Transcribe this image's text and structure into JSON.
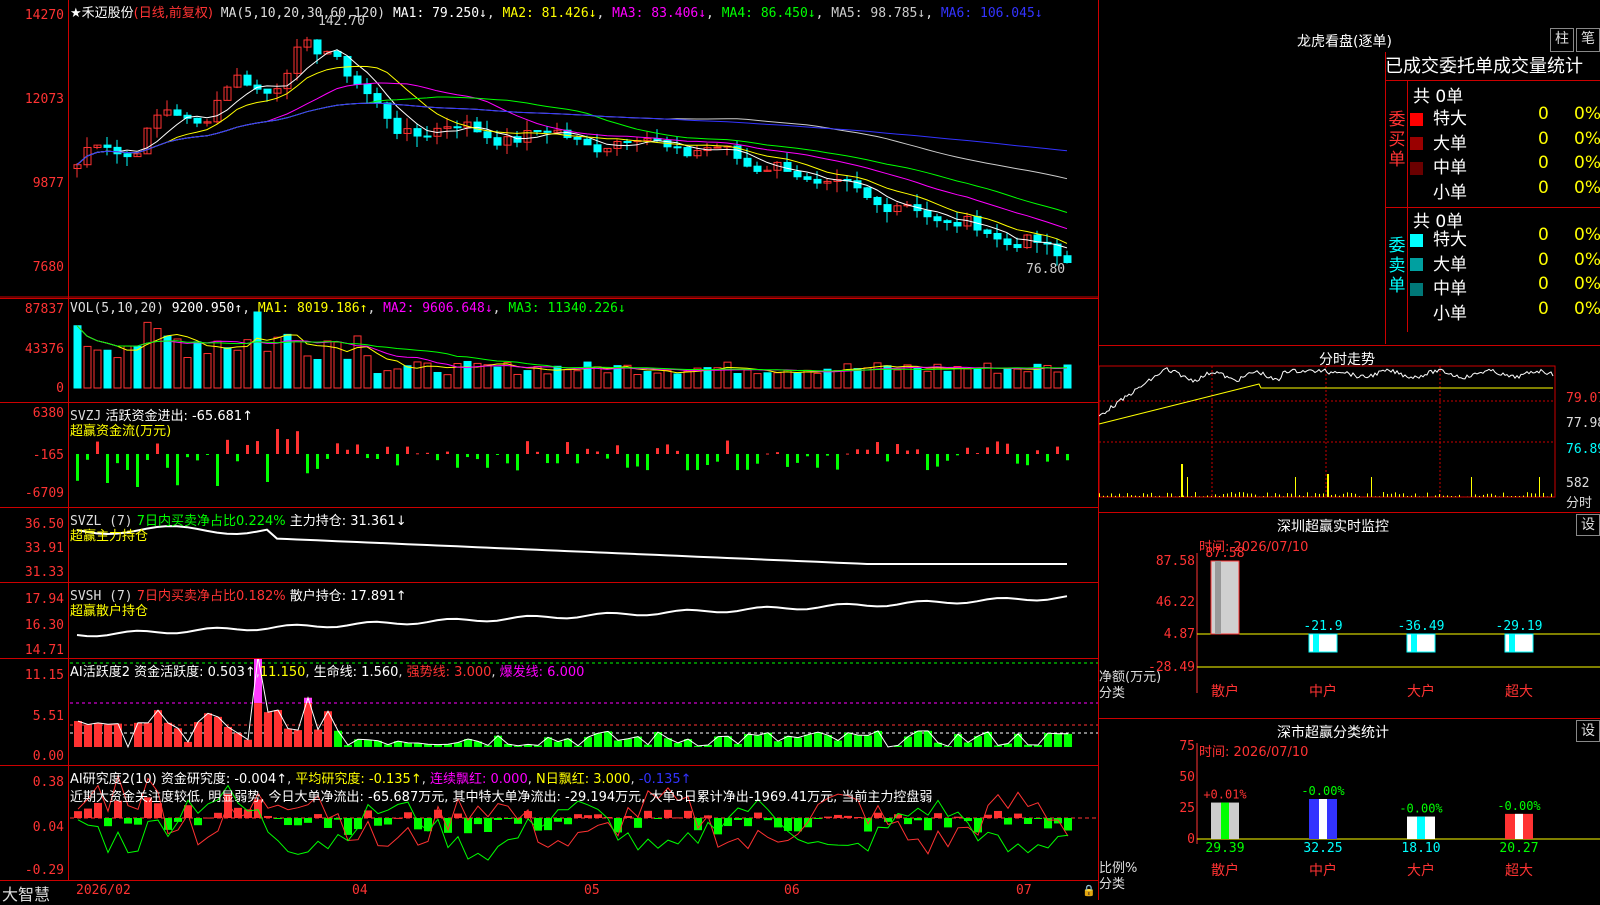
{
  "stock": {
    "name": "★禾迈股份",
    "mode": "(日线,前复权)"
  },
  "price_panel": {
    "ma_label": "MA(5,10,20,30,60,120)",
    "ma1": "MA1: 79.250↓",
    "ma2": "MA2: 81.426↓",
    "ma3": "MA3: 83.406↓",
    "ma4": "MA4: 86.450↓",
    "ma5": "MA5: 98.785↓",
    "ma6": "MA6: 106.045↓",
    "yticks": [
      "14270",
      "12073",
      "9877",
      "7680"
    ],
    "high_label": "142.70",
    "low_label": "76.80"
  },
  "vol_panel": {
    "label": "VOL(5,10,20)",
    "val": "9200.950↑",
    "ma1": "MA1: 8019.186↑",
    "ma2": "MA2: 9606.648↓",
    "ma3": "MA3: 11340.226↓",
    "yticks": [
      "87837",
      "43376",
      "0"
    ]
  },
  "svzj_panel": {
    "label": "SVZJ",
    "title": "活跃资金进出: -65.681↑",
    "sub": "超赢资金流(万元)",
    "yticks": [
      "6380",
      "-165",
      "-6709"
    ]
  },
  "svzl_panel": {
    "label": "SVZL (7)",
    "t1": "7日内买卖净占比0.224%",
    "t2": "主力持仓: 31.361↓",
    "sub": "超赢主力持仓",
    "yticks": [
      "36.50",
      "33.91",
      "31.33"
    ]
  },
  "svsh_panel": {
    "label": "SVSH (7)",
    "t1": "7日内买卖净占比0.182%",
    "t2": "散户持仓: 17.891↑",
    "sub": "超赢散户持仓",
    "yticks": [
      "17.94",
      "16.30",
      "14.71"
    ]
  },
  "ai_panel": {
    "label": "AI活跃度2",
    "t1": "资金活跃度: 0.503↑",
    "t2": "11.150",
    "t3": "生命线: 1.560",
    "t4": "强势线: 3.000",
    "t5": "爆发线: 6.000",
    "yticks": [
      "11.15",
      "5.51",
      "0.00"
    ]
  },
  "res_panel": {
    "label": "AI研究度2(10)",
    "t1": "资金研究度: -0.004↑",
    "t2": "平均研究度: -0.135↑",
    "t3": "连续飘红: 0.000",
    "t4": "N日飘红: 3.000",
    "t5": "-0.135↑",
    "comment": "近期大资金关注度较低, 明显弱势, 今日大单净流出: -65.687万元, 其中特大单净流出: -29.194万元, 大单5日累计净出-1969.41万元, 当前主力控盘弱",
    "yticks": [
      "0.38",
      "0.04",
      "-0.29"
    ]
  },
  "xaxis": {
    "brand": "大智慧",
    "labels": [
      "2026/02",
      "04",
      "05",
      "06",
      "07"
    ]
  },
  "longhu": {
    "title": "龙虎看盘(逐单)",
    "btn1": "柱",
    "btn2": "笔",
    "header": "已成交委托单成交量统计",
    "buy": {
      "side": "委买单",
      "total": "共 0单",
      "rows": [
        {
          "name": "特大",
          "color": "#ff0000",
          "v": "0",
          "p": "0%"
        },
        {
          "name": "大单",
          "color": "#9a0000",
          "v": "0",
          "p": "0%"
        },
        {
          "name": "中单",
          "color": "#6a0000",
          "v": "0",
          "p": "0%"
        },
        {
          "name": "小单",
          "color": "",
          "v": "0",
          "p": "0%"
        }
      ]
    },
    "sell": {
      "side": "委卖单",
      "total": "共 0单",
      "rows": [
        {
          "name": "特大",
          "color": "#00ffff",
          "v": "0",
          "p": "0%"
        },
        {
          "name": "大单",
          "color": "#00a0a0",
          "v": "0",
          "p": "0%"
        },
        {
          "name": "中单",
          "color": "#007878",
          "v": "0",
          "p": "0%"
        },
        {
          "name": "小单",
          "color": "",
          "v": "0",
          "p": "0%"
        }
      ]
    }
  },
  "fenshi": {
    "title": "分时走势",
    "yticks": [
      "79.07",
      "77.98",
      "76.89"
    ],
    "vol": "582",
    "vol_unit": "分时"
  },
  "monitor": {
    "title": "深圳超赢实时监控",
    "btn": "设",
    "time": "时间: 2026/07/10",
    "yticks": [
      "87.58",
      "46.22",
      "4.87",
      "-28.49"
    ],
    "unit": "净额(万元)",
    "cat": "分类",
    "bars": [
      {
        "name": "散户",
        "value": 87.58,
        "label": "87.58"
      },
      {
        "name": "中户",
        "value": -21.9,
        "label": "-21.9"
      },
      {
        "name": "大户",
        "value": -36.49,
        "label": "-36.49"
      },
      {
        "name": "超大",
        "value": -29.19,
        "label": "-29.19"
      }
    ]
  },
  "classify": {
    "title": "深市超赢分类统计",
    "btn": "设",
    "time": "时间: 2026/07/10",
    "yticks": [
      "75",
      "50",
      "25",
      "0"
    ],
    "unit": "比例%",
    "cat": "分类",
    "bars": [
      {
        "name": "散户",
        "value": 29.39,
        "label": "29.39",
        "delta": "+0.01%"
      },
      {
        "name": "中户",
        "value": 32.25,
        "label": "32.25",
        "delta": "-0.00%"
      },
      {
        "name": "大户",
        "value": 18.1,
        "label": "18.10",
        "delta": "-0.00%"
      },
      {
        "name": "超大",
        "value": 20.27,
        "label": "20.27",
        "delta": "-0.00%"
      }
    ]
  }
}
